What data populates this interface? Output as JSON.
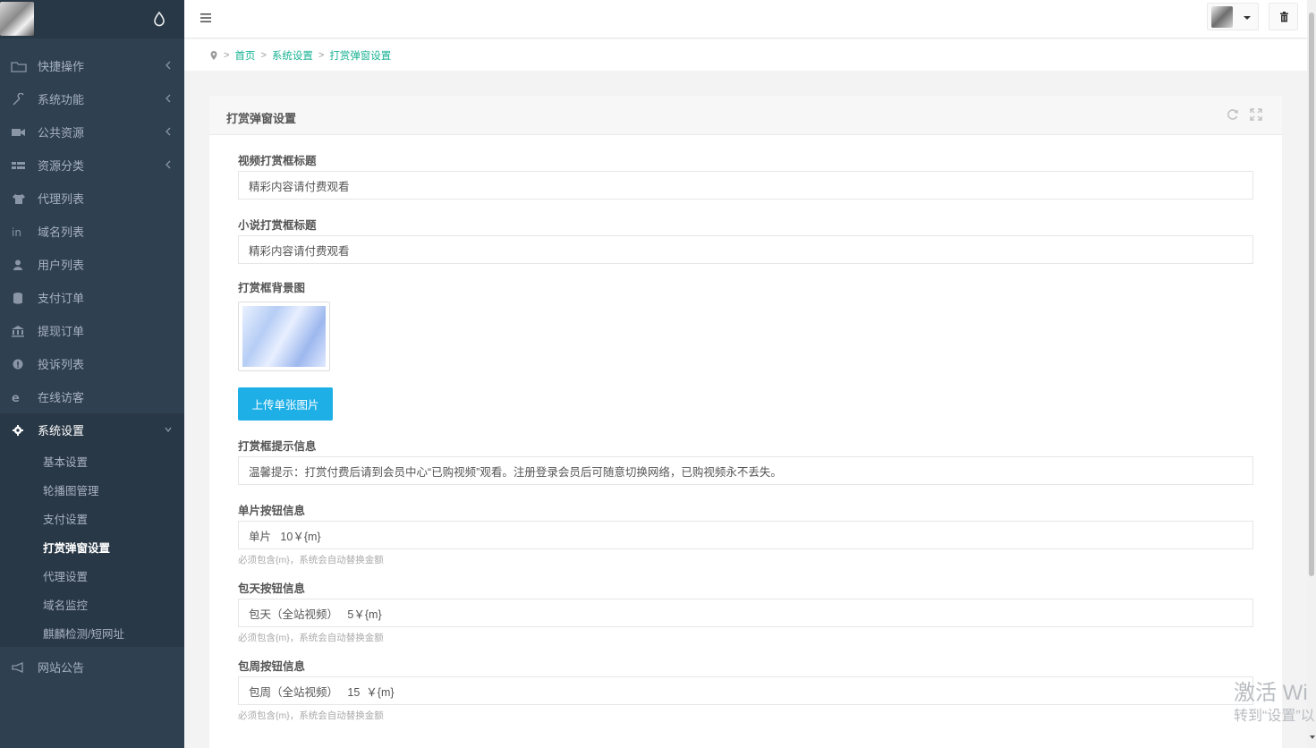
{
  "sidebar": {
    "items": [
      {
        "label": "快捷操作",
        "icon": "folder-icon",
        "chevron": true
      },
      {
        "label": "系统功能",
        "icon": "wrench-icon",
        "chevron": true
      },
      {
        "label": "公共资源",
        "icon": "video-camera-icon",
        "chevron": true
      },
      {
        "label": "资源分类",
        "icon": "list-icon",
        "chevron": true
      },
      {
        "label": "代理列表",
        "icon": "shirt-icon",
        "chevron": false
      },
      {
        "label": "域名列表",
        "icon": "linkedin-icon",
        "chevron": false
      },
      {
        "label": "用户列表",
        "icon": "user-icon",
        "chevron": false
      },
      {
        "label": "支付订单",
        "icon": "database-icon",
        "chevron": false
      },
      {
        "label": "提现订单",
        "icon": "bank-icon",
        "chevron": false
      },
      {
        "label": "投诉列表",
        "icon": "info-circle-icon",
        "chevron": false
      },
      {
        "label": "在线访客",
        "icon": "ie-icon",
        "chevron": false
      }
    ],
    "settings": {
      "label": "系统设置",
      "subitems": [
        "基本设置",
        "轮播图管理",
        "支付设置",
        "打赏弹窗设置",
        "代理设置",
        "域名监控",
        "麒麟检测/短网址"
      ]
    },
    "notice": {
      "label": "网站公告"
    }
  },
  "breadcrumb": {
    "home": "首页",
    "section": "系统设置",
    "current": "打赏弹窗设置"
  },
  "panel": {
    "title": "打赏弹窗设置"
  },
  "form": {
    "video_title": {
      "label": "视频打赏框标题",
      "value": "精彩内容请付费观看"
    },
    "novel_title": {
      "label": "小说打赏框标题",
      "value": "精彩内容请付费观看"
    },
    "bg_image": {
      "label": "打赏框背景图",
      "upload_label": "上传单张图片"
    },
    "tip_info": {
      "label": "打赏框提示信息",
      "value": "温馨提示：打赏付费后请到会员中心“已购视频”观看。注册登录会员后可随意切换网络，已购视频永不丢失。"
    },
    "single_btn": {
      "label": "单片按钮信息",
      "value": "单片   10￥{m}",
      "help": "必须包含{m}，系统会自动替换金额"
    },
    "day_btn": {
      "label": "包天按钮信息",
      "value": "包天（全站视频）   5￥{m}",
      "help": "必须包含{m}，系统会自动替换金额"
    },
    "week_btn": {
      "label": "包周按钮信息",
      "value": "包周（全站视频）   15  ￥{m}",
      "help": "必须包含{m}，系统会自动替换金额"
    }
  },
  "watermark": {
    "line1": "激活 Wi",
    "line2": "转到“设置”以"
  }
}
